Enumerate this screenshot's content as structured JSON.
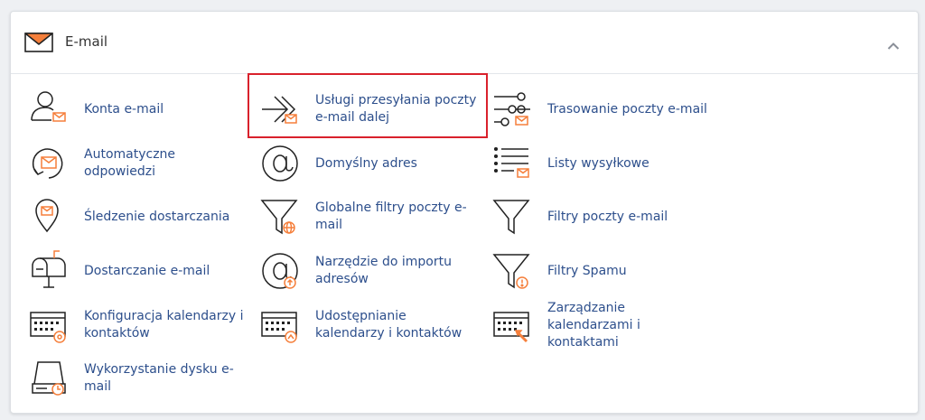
{
  "section": {
    "title": "E-mail",
    "icon": "mail-envelope-icon",
    "collapse_icon": "chevron-up-icon"
  },
  "colors": {
    "link": "#2d4f8c",
    "accent": "#f57f3b",
    "icon_stroke": "#222222",
    "highlight": "#d9212c"
  },
  "items": {
    "konta": "Konta e-mail",
    "uslugi": "Usługi przesyłania poczty e-mail dalej",
    "trasowanie": "Trasowanie poczty e-mail",
    "autoodp": "Automatyczne odpowiedzi",
    "domyslny": "Domyślny adres",
    "listy": "Listy wysyłkowe",
    "sledzenie": "Śledzenie dostarczania",
    "globalne": "Globalne filtry poczty e-mail",
    "filtry": "Filtry poczty e-mail",
    "dostarczanie": "Dostarczanie e-mail",
    "import": "Narzędzie do importu adresów",
    "spam": "Filtry Spamu",
    "konfiguracja": "Konfiguracja kalendarzy i kontaktów",
    "udostepnianie": "Udostępnianie kalendarzy i kontaktów",
    "zarzadzanie": "Zarządzanie kalendarzami i kontaktami",
    "dysk": "Wykorzystanie dysku e-mail"
  }
}
